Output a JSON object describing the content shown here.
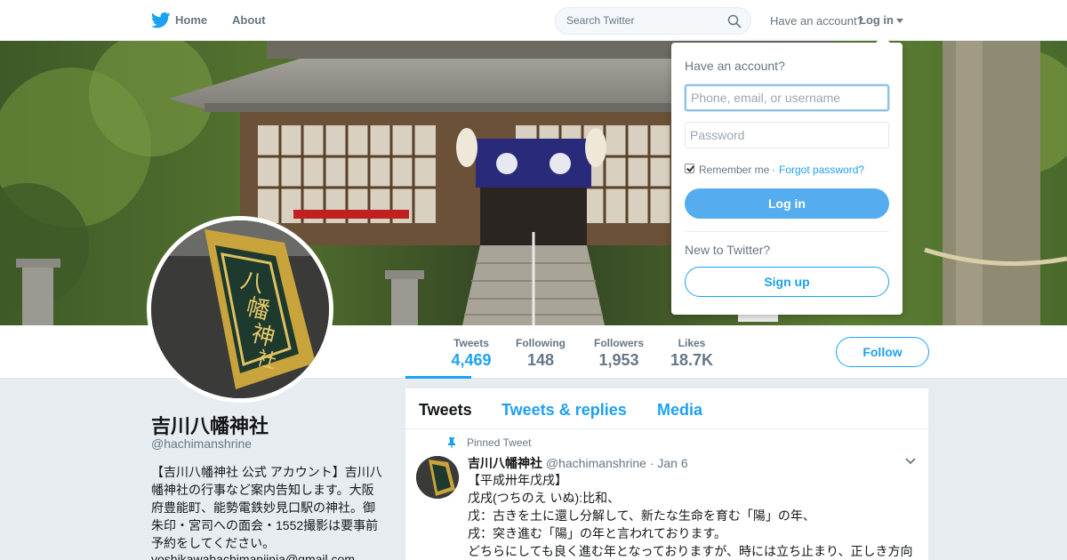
{
  "nav": {
    "home_label": "Home",
    "about_label": "About",
    "search_placeholder": "Search Twitter",
    "have_account": "Have an account?",
    "login_label": "Log in"
  },
  "stats": [
    {
      "label": "Tweets",
      "value": "4,469"
    },
    {
      "label": "Following",
      "value": "148"
    },
    {
      "label": "Followers",
      "value": "1,953"
    },
    {
      "label": "Likes",
      "value": "18.7K"
    }
  ],
  "follow_label": "Follow",
  "profile": {
    "name": "吉川八幡神社",
    "handle": "@hachimanshrine",
    "bio_lines": [
      "【吉川八幡神社 公式 アカウント】吉川八",
      "幡神社の行事など案内告知します。大阪",
      "府豊能町、能勢電鉄妙見口駅の神社。御",
      "朱印・宮司への面会・1552撮影は要事前",
      "予約をしてください。"
    ],
    "email": "yoshikawahachimanjinja@gmail.com"
  },
  "tabs": [
    "Tweets",
    "Tweets & replies",
    "Media"
  ],
  "tweet": {
    "pinned_label": "Pinned Tweet",
    "author": "吉川八幡神社",
    "handle": "@hachimanshrine",
    "separator": "·",
    "date": "Jan 6",
    "lines": [
      "【平成卅年戊戌】",
      "戊戌(つちのえ いぬ):比和、",
      "戊：古きを土に還し分解して、新たな生命を育む「陽」の年、",
      "戌：突き進む「陽」の年と言われております。",
      "どちらにしても良く進む年となっておりますが、時には立ち止まり、正しき方向"
    ]
  },
  "login_dropdown": {
    "title": "Have an account?",
    "username_placeholder": "Phone, email, or username",
    "password_placeholder": "Password",
    "remember_label": "Remember me",
    "separator": "·",
    "forgot_label": "Forgot password?",
    "login_button": "Log in",
    "new_label": "New to Twitter?",
    "signup_button": "Sign up"
  },
  "colors": {
    "accent": "#1da1f2",
    "login_button": "#55acee",
    "background": "#e6ecf0"
  }
}
